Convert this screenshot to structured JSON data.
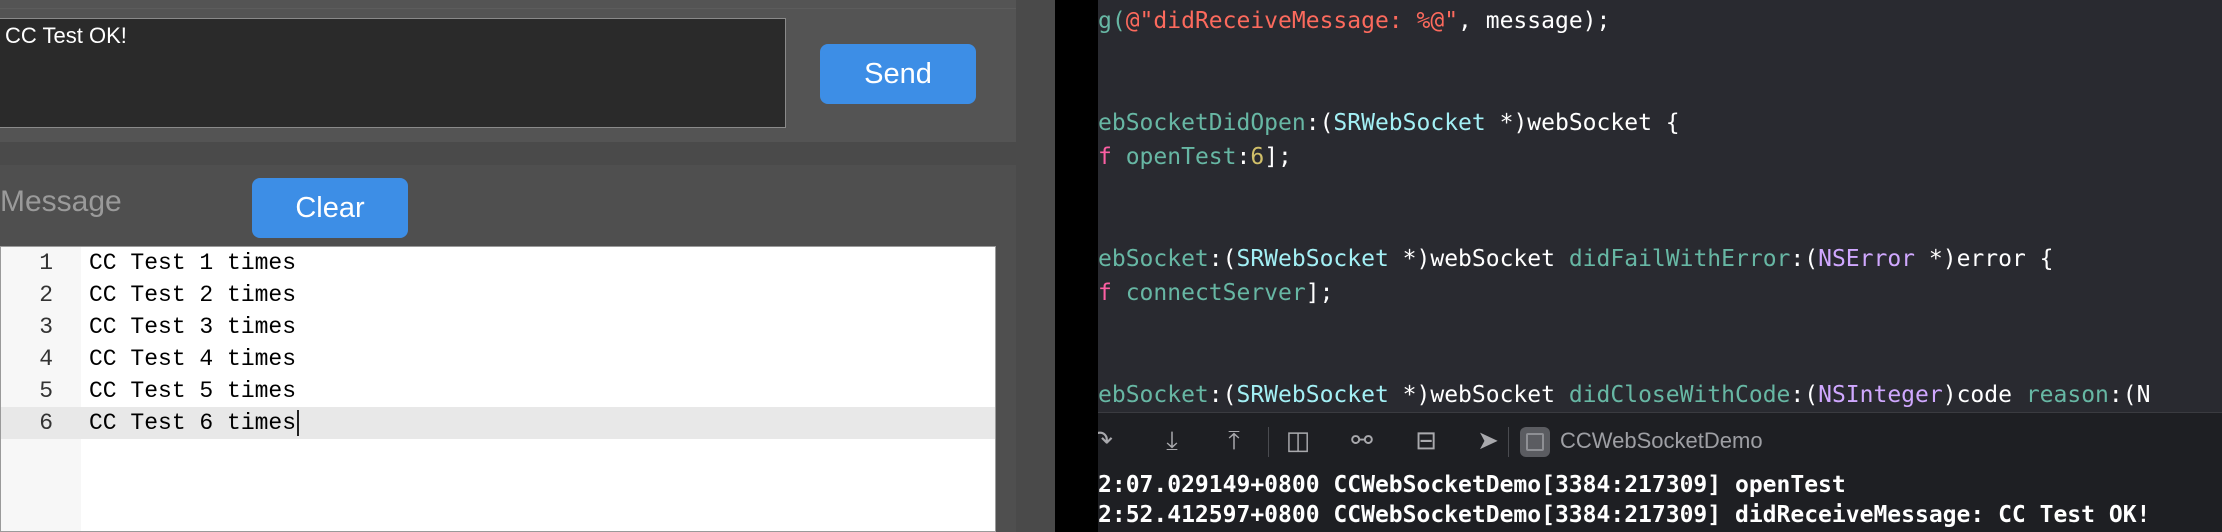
{
  "web_page": {
    "message_input_value": "CC Test OK!",
    "send_button": "Send",
    "message_label": "Message",
    "clear_button": "Clear",
    "log_lines": [
      {
        "num": "1",
        "text": "CC Test 1 times"
      },
      {
        "num": "2",
        "text": "CC Test 2 times"
      },
      {
        "num": "3",
        "text": "CC Test 3 times"
      },
      {
        "num": "4",
        "text": "CC Test 4 times"
      },
      {
        "num": "5",
        "text": "CC Test 5 times"
      },
      {
        "num": "6",
        "text": "CC Test 6 times"
      }
    ]
  },
  "xcode": {
    "code": {
      "l1_fn": "g(",
      "l1_str": "@\"didReceiveMessage: %@\"",
      "l1_rest": ", message);",
      "l2_method": "ebSocketDidOpen",
      "l2_a": ":(",
      "l2_class": "SRWebSocket",
      "l2_b": " *)webSocket {",
      "l3_kw": "f ",
      "l3_method": "openTest",
      "l3_a": ":",
      "l3_num": "6",
      "l3_b": "];",
      "l4_method": "ebSocket",
      "l4_a": ":(",
      "l4_class": "SRWebSocket",
      "l4_b": " *)webSocket ",
      "l4_method2": "didFailWithError",
      "l4_c": ":(",
      "l4_type": "NSError",
      "l4_d": " *)error {",
      "l5_kw": "f ",
      "l5_method": "connectServer",
      "l5_b": "];",
      "l6_method": "ebSocket",
      "l6_a": ":(",
      "l6_class": "SRWebSocket",
      "l6_b": " *)webSocket ",
      "l6_method2": "didCloseWithCode",
      "l6_c": ":(",
      "l6_type": "NSInteger",
      "l6_d": ")code ",
      "l6_method3": "reason",
      "l6_e": ":(N"
    },
    "scheme_name": "CCWebSocketDemo",
    "console_lines": [
      "2:07.029149+0800 CCWebSocketDemo[3384:217309] openTest",
      "2:52.412597+0800 CCWebSocketDemo[3384:217309] didReceiveMessage: CC Test OK!"
    ],
    "debug_icons": [
      "step-over-icon",
      "step-into-icon",
      "step-out-icon",
      "view-debugger-icon",
      "memory-graph-icon",
      "environment-overrides-icon",
      "simulate-location-icon"
    ]
  }
}
